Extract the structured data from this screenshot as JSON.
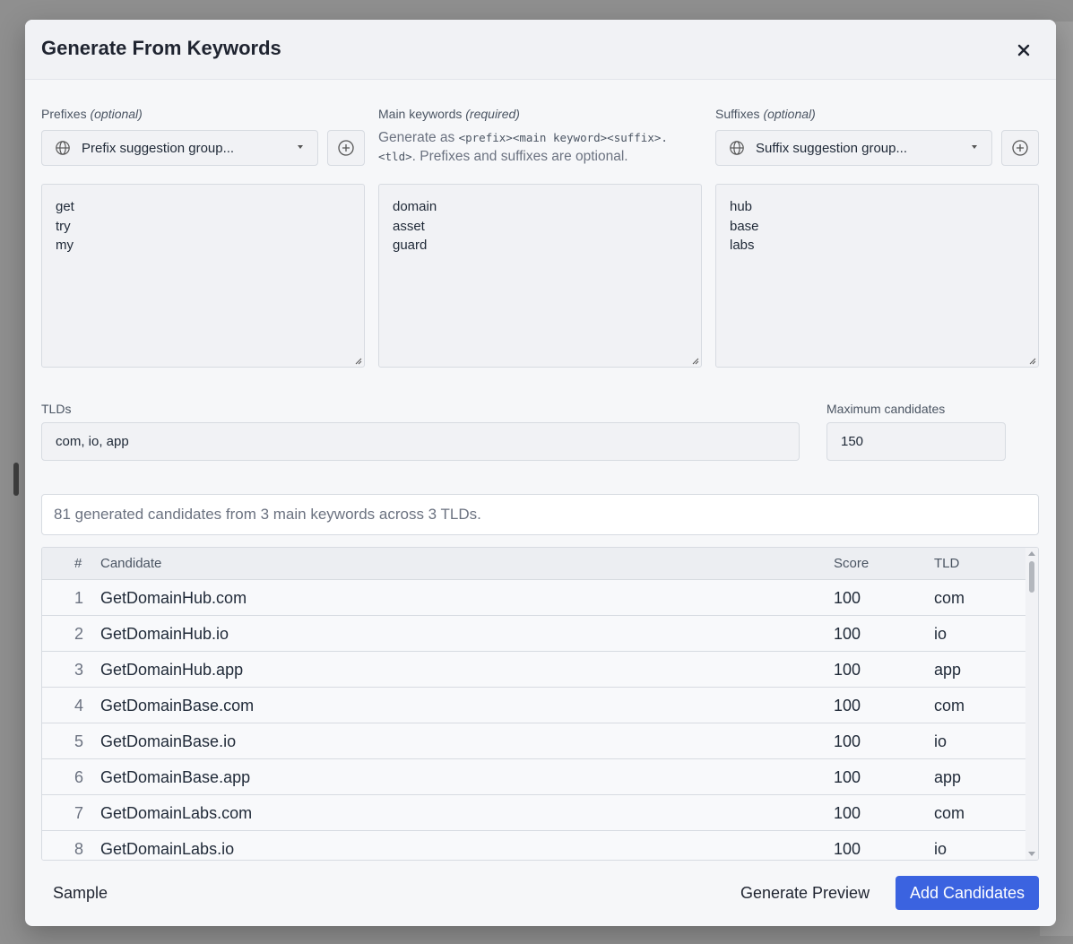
{
  "modal": {
    "title": "Generate From Keywords",
    "close_label": "×"
  },
  "prefixes": {
    "label": "Prefixes",
    "qualifier": "(optional)",
    "select_value": "Prefix suggestion group...",
    "lines": [
      "get",
      "try",
      "my"
    ]
  },
  "main_keywords": {
    "label": "Main keywords",
    "qualifier": "(required)",
    "hint_before": "Generate as ",
    "hint_code_1": "<prefix><main keyword><suffix>.",
    "hint_code_2": "<tld>",
    "hint_after": ". Prefixes and suffixes are optional.",
    "lines": [
      "domain",
      "asset",
      "guard"
    ]
  },
  "suffixes": {
    "label": "Suffixes",
    "qualifier": "(optional)",
    "select_value": "Suffix suggestion group...",
    "lines": [
      "hub",
      "base",
      "labs"
    ]
  },
  "tlds": {
    "label": "TLDs",
    "value": "com, io, app"
  },
  "max_candidates": {
    "label": "Maximum candidates",
    "value": "150"
  },
  "summary": "81 generated candidates from 3 main keywords across 3 TLDs.",
  "table": {
    "headers": {
      "num": "#",
      "candidate": "Candidate",
      "score": "Score",
      "tld": "TLD"
    },
    "rows": [
      {
        "num": "1",
        "candidate": "GetDomainHub.com",
        "score": "100",
        "tld": "com"
      },
      {
        "num": "2",
        "candidate": "GetDomainHub.io",
        "score": "100",
        "tld": "io"
      },
      {
        "num": "3",
        "candidate": "GetDomainHub.app",
        "score": "100",
        "tld": "app"
      },
      {
        "num": "4",
        "candidate": "GetDomainBase.com",
        "score": "100",
        "tld": "com"
      },
      {
        "num": "5",
        "candidate": "GetDomainBase.io",
        "score": "100",
        "tld": "io"
      },
      {
        "num": "6",
        "candidate": "GetDomainBase.app",
        "score": "100",
        "tld": "app"
      },
      {
        "num": "7",
        "candidate": "GetDomainLabs.com",
        "score": "100",
        "tld": "com"
      },
      {
        "num": "8",
        "candidate": "GetDomainLabs.io",
        "score": "100",
        "tld": "io"
      }
    ]
  },
  "footer": {
    "sample_label": "Sample",
    "preview_label": "Generate Preview",
    "add_label": "Add Candidates"
  },
  "colors": {
    "primary": "#3b63e0",
    "modal_bg": "#f6f7f9",
    "border": "#d7dbe1"
  }
}
